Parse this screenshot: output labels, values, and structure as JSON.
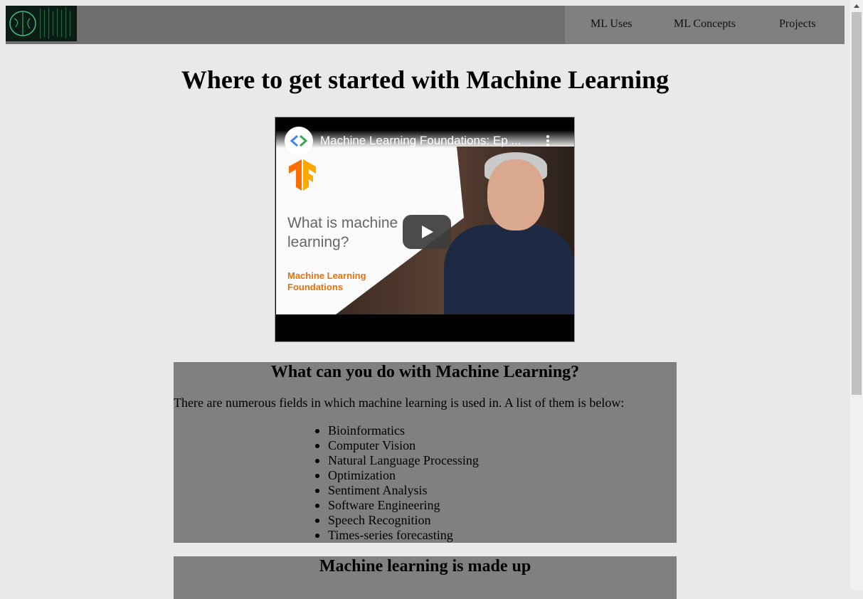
{
  "nav": {
    "links": [
      "ML Uses",
      "ML Concepts",
      "Projects"
    ]
  },
  "page": {
    "title": "Where to get started with Machine Learning"
  },
  "video": {
    "title": "Machine Learning Foundations: Ep ...",
    "thumbnail_question": "What is machine\nlearning?",
    "thumbnail_brand": "Machine Learning\nFoundations"
  },
  "uses_section": {
    "heading": "What can you do with Machine Learning?",
    "intro": "There are numerous fields in which machine learning is used in. A list of them is below:",
    "items": [
      "Bioinformatics",
      "Computer Vision",
      "Natural Language Processing",
      "Optimization",
      "Sentiment Analysis",
      "Software Engineering",
      "Speech Recognition",
      "Times-series forecasting"
    ]
  },
  "concepts_section": {
    "heading": "Machine learning is made up"
  },
  "colors": {
    "page_bg": "#e9e9e9",
    "navbar_bg": "#6f6f6f",
    "section_bg": "#808080",
    "tf_orange": "#e8710a"
  }
}
